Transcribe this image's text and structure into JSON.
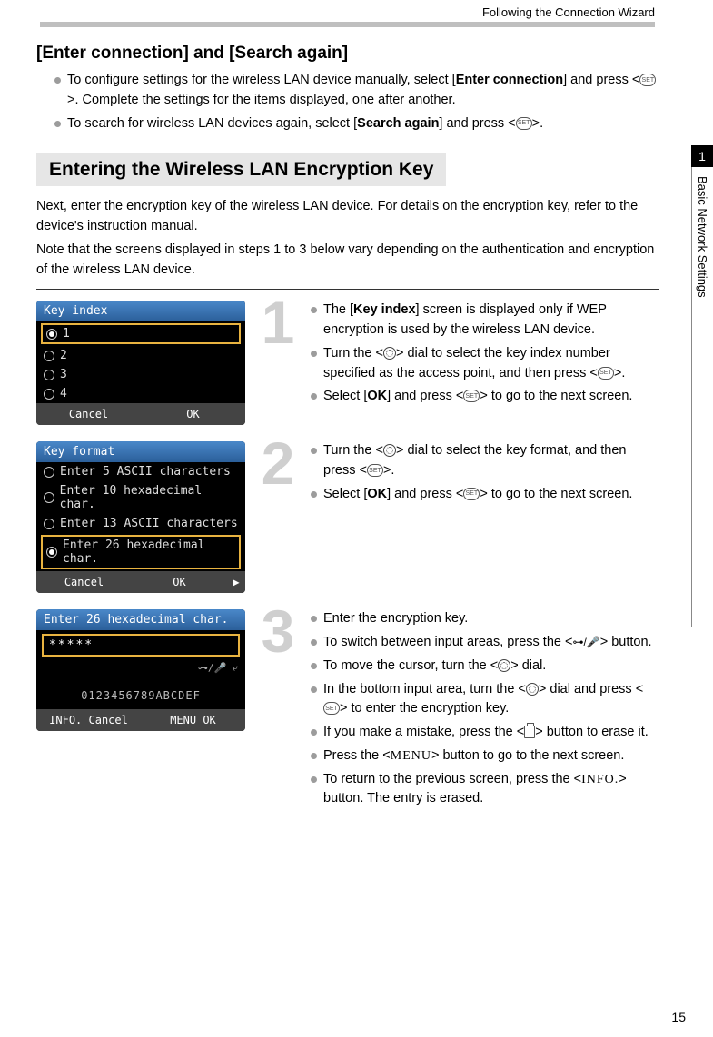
{
  "header": {
    "runningTitle": "Following the Connection Wizard"
  },
  "section1": {
    "title": "[Enter connection] and [Search again]",
    "bullets": [
      {
        "pre": "To configure settings for the wireless LAN device manually, select [",
        "bold1": "Enter connection",
        "mid": "] and press <",
        "icon1": "set",
        "post": ">. Complete the settings for the items displayed, one after another."
      },
      {
        "pre": "To search for wireless LAN devices again, select [",
        "bold1": "Search again",
        "mid": "] and press <",
        "icon1": "set",
        "post": ">."
      }
    ]
  },
  "section2": {
    "barTitle": "Entering the Wireless LAN Encryption Key",
    "para1": "Next, enter the encryption key of the wireless LAN device. For details on the encryption key, refer to the device's instruction manual.",
    "para2": "Note that the screens displayed in steps 1 to 3 below vary depending on the authentication and encryption of the wireless LAN device."
  },
  "steps": [
    {
      "num": "1",
      "screen": {
        "title": "Key index",
        "options": [
          "1",
          "2",
          "3",
          "4"
        ],
        "selectedIndex": 0,
        "cancel": "Cancel",
        "ok": "OK",
        "arrow": ""
      },
      "bullets": [
        {
          "parts": [
            {
              "t": "The ["
            },
            {
              "b": "Key index"
            },
            {
              "t": "] screen is displayed only if WEP encryption is used by the wireless LAN device."
            }
          ]
        },
        {
          "parts": [
            {
              "t": "Turn the <"
            },
            {
              "icon": "dial"
            },
            {
              "t": "> dial to select the key index number specified as the access point, and then press <"
            },
            {
              "icon": "set"
            },
            {
              "t": ">."
            }
          ]
        },
        {
          "parts": [
            {
              "t": "Select ["
            },
            {
              "b": "OK"
            },
            {
              "t": "] and press <"
            },
            {
              "icon": "set"
            },
            {
              "t": "> to go to the next screen."
            }
          ]
        }
      ]
    },
    {
      "num": "2",
      "screen": {
        "title": "Key format",
        "options": [
          "Enter 5 ASCII characters",
          "Enter 10 hexadecimal char.",
          "Enter 13 ASCII characters",
          "Enter 26 hexadecimal char."
        ],
        "selectedIndex": 3,
        "cancel": "Cancel",
        "ok": "OK",
        "arrow": "▶"
      },
      "bullets": [
        {
          "parts": [
            {
              "t": "Turn the <"
            },
            {
              "icon": "dial"
            },
            {
              "t": "> dial to select the key format, and then press <"
            },
            {
              "icon": "set"
            },
            {
              "t": ">."
            }
          ]
        },
        {
          "parts": [
            {
              "t": "Select ["
            },
            {
              "b": "OK"
            },
            {
              "t": "] and press <"
            },
            {
              "icon": "set"
            },
            {
              "t": "> to go to the next screen."
            }
          ]
        }
      ]
    },
    {
      "num": "3",
      "screen": {
        "title": "Enter 26 hexadecimal char.",
        "masked": "*****",
        "modeRow": "⊶/🎤 ⤶",
        "guide": "0123456789ABCDEF",
        "footLeft": "INFO. Cancel",
        "footRight": "MENU OK"
      },
      "bullets": [
        {
          "parts": [
            {
              "t": "Enter the encryption key."
            }
          ]
        },
        {
          "parts": [
            {
              "t": "To switch between input areas, press the <"
            },
            {
              "icon": "keymic"
            },
            {
              "t": "> button."
            }
          ]
        },
        {
          "parts": [
            {
              "t": "To move the cursor, turn the <"
            },
            {
              "icon": "dial"
            },
            {
              "t": "> dial."
            }
          ]
        },
        {
          "parts": [
            {
              "t": "In the bottom input area, turn the <"
            },
            {
              "icon": "dial"
            },
            {
              "t": "> dial and press <"
            },
            {
              "icon": "set"
            },
            {
              "t": "> to enter the encryption key."
            }
          ]
        },
        {
          "parts": [
            {
              "t": "If you make a mistake, press the <"
            },
            {
              "icon": "trash"
            },
            {
              "t": "> button to erase it."
            }
          ]
        },
        {
          "parts": [
            {
              "t": "Press the <"
            },
            {
              "menu": "MENU"
            },
            {
              "t": "> button to go to the next screen."
            }
          ]
        },
        {
          "parts": [
            {
              "t": "To return to the previous screen, press the <"
            },
            {
              "info": "INFO."
            },
            {
              "t": "> button. The entry is erased."
            }
          ]
        }
      ]
    }
  ],
  "sideTab": {
    "num": "1",
    "label": "Basic Network Settings"
  },
  "pageNumber": "15",
  "iconLabels": {
    "set": "SET"
  }
}
